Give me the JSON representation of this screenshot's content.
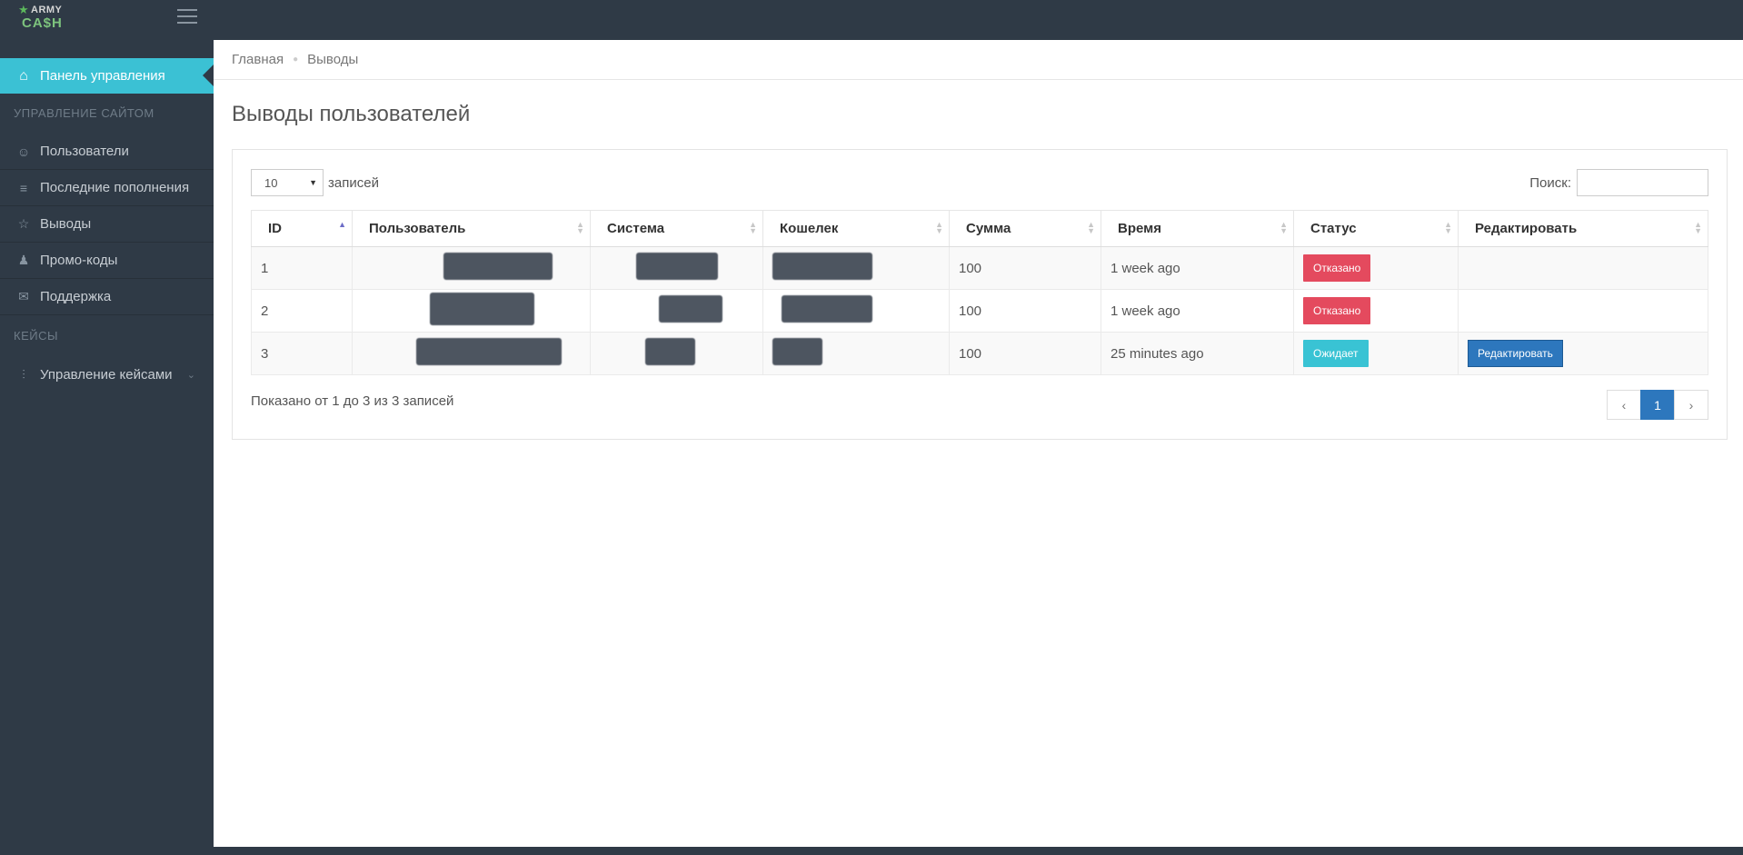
{
  "app": {
    "logo_top": "ARMY",
    "logo_bottom": "CA$H"
  },
  "sidebar": {
    "active": {
      "label": "Панель управления",
      "icon": "home-icon"
    },
    "section1": "УПРАВЛЕНИЕ САЙТОМ",
    "items": [
      {
        "label": "Пользователи",
        "icon": "user-icon"
      },
      {
        "label": "Последние пополнения",
        "icon": "database-icon"
      },
      {
        "label": "Выводы",
        "icon": "star-icon"
      },
      {
        "label": "Промо-коды",
        "icon": "users-icon"
      },
      {
        "label": "Поддержка",
        "icon": "envelope-icon"
      }
    ],
    "section2": "КЕЙСЫ",
    "cases": {
      "label": "Управление кейсами",
      "icon": "sliders-icon"
    }
  },
  "breadcrumb": {
    "home": "Главная",
    "current": "Выводы"
  },
  "page": {
    "title": "Выводы пользователей"
  },
  "table_controls": {
    "length_value": "10",
    "length_suffix": "записей",
    "search_label": "Поиск:",
    "search_value": ""
  },
  "table": {
    "columns": [
      "ID",
      "Пользователь",
      "Система",
      "Кошелек",
      "Сумма",
      "Время",
      "Статус",
      "Редактировать"
    ],
    "rows": [
      {
        "id": "1",
        "sum": "100",
        "time": "1 week ago",
        "status": "Отказано",
        "status_color": "#e44a5e",
        "edit": ""
      },
      {
        "id": "2",
        "sum": "100",
        "time": "1 week ago",
        "status": "Отказано",
        "status_color": "#e44a5e",
        "edit": ""
      },
      {
        "id": "3",
        "sum": "100",
        "time": "25 minutes ago",
        "status": "Ожидает",
        "status_color": "#39c3d4",
        "edit": "Редактировать"
      }
    ]
  },
  "footer": {
    "info": "Показано от 1 до 3 из 3 записей",
    "prev": "‹",
    "page": "1",
    "next": "›"
  }
}
